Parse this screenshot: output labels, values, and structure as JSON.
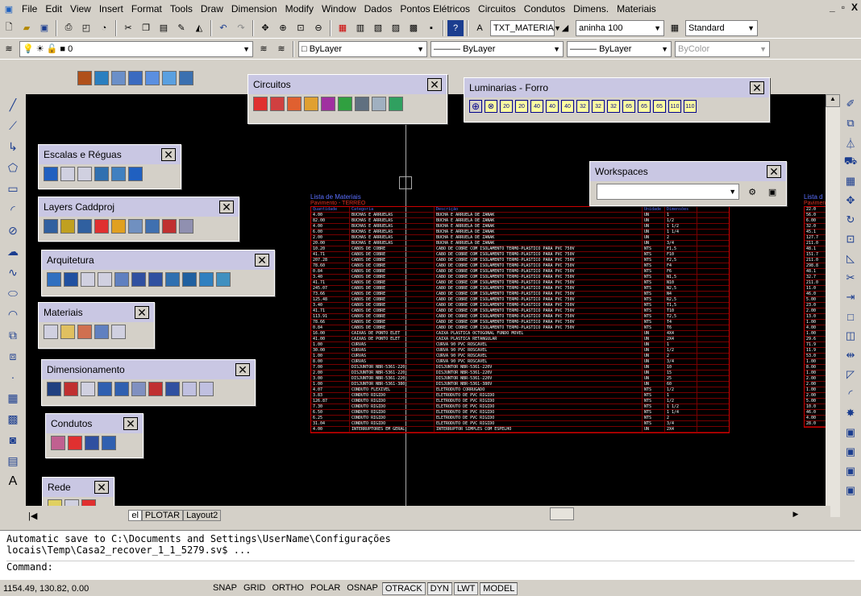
{
  "menu": [
    "File",
    "Edit",
    "View",
    "Insert",
    "Format",
    "Tools",
    "Draw",
    "Dimension",
    "Modify",
    "Window",
    "Dados",
    "Pontos Elétricos",
    "Circuitos",
    "Condutos",
    "Dimens.",
    "Materiais"
  ],
  "window_buttons": {
    "min": "_",
    "max": "▫",
    "close": "X"
  },
  "toolbar1": {
    "style_combo": "TXT_MATERIA",
    "dim_combo": "aninha 100",
    "table_combo": "Standard"
  },
  "toolbar2": {
    "layer_combo": "0",
    "color_combo": "ByLayer",
    "ltype_combo": "ByLayer",
    "lweight_combo": "ByLayer",
    "plot_combo": "ByColor"
  },
  "panels": {
    "circuitos": {
      "title": "Circuitos"
    },
    "luminarias": {
      "title": "Luminarias - Forro",
      "labels": [
        "20",
        "20",
        "40",
        "40",
        "40",
        "32",
        "32",
        "32",
        "65",
        "65",
        "65",
        "110",
        "110"
      ]
    },
    "escalas": {
      "title": "Escalas e Réguas"
    },
    "layers": {
      "title": "Layers Caddproj"
    },
    "arquitetura": {
      "title": "Arquitetura"
    },
    "materiais": {
      "title": "Materiais"
    },
    "dimensionamento": {
      "title": "Dimensionamento"
    },
    "condutos": {
      "title": "Condutos"
    },
    "rede": {
      "title": "Rede"
    },
    "workspaces": {
      "title": "Workspaces"
    }
  },
  "drawing": {
    "table_title": "Lista de Materiais",
    "table_subtitle": "Pavimento - TERREO",
    "headers": [
      "Quantidade",
      "Categoria",
      "Descrição",
      "Unidade",
      "Dimensões"
    ],
    "rows": [
      [
        "4.00",
        "BUCHAS E ARRUELAS",
        "BUCHA E ARRUELA DE ZANAK",
        "UN",
        "1"
      ],
      [
        "82.00",
        "BUCHAS E ARRUELAS",
        "BUCHA E ARRUELA DE ZANAK",
        "UN",
        "1/2"
      ],
      [
        "4.00",
        "BUCHAS E ARRUELAS",
        "BUCHA E ARRUELA DE ZANAK",
        "UN",
        "1 1/2"
      ],
      [
        "6.00",
        "BUCHAS E ARRUELAS",
        "BUCHA E ARRUELA DE ZANAK",
        "UN",
        "1 1/4"
      ],
      [
        "2.00",
        "BUCHAS E ARRUELAS",
        "BUCHA E ARRUELA DE ZANAK",
        "UN",
        "2"
      ],
      [
        "20.00",
        "BUCHAS E ARRUELAS",
        "BUCHA E ARRUELA DE ZANAK",
        "UN",
        "3/4"
      ],
      [
        "10.20",
        "CABOS DE COBRE",
        "CABO DE COBRE COM ISOLAMENTO TERMO-PLASTICO PARA PVC 750V",
        "NTS",
        "F1,5"
      ],
      [
        "41.71",
        "CABOS DE COBRE",
        "CABO DE COBRE COM ISOLAMENTO TERMO-PLASTICO PARA PVC 750V",
        "NTS",
        "F10"
      ],
      [
        "207.28",
        "CABOS DE COBRE",
        "CABO DE COBRE COM ISOLAMENTO TERMO-PLASTICO PARA PVC 750V",
        "NTS",
        "F2,5"
      ],
      [
        "78.60",
        "CABOS DE COBRE",
        "CABO DE COBRE COM ISOLAMENTO TERMO-PLASTICO PARA PVC 750V",
        "NTS",
        "F4"
      ],
      [
        "0.84",
        "CABOS DE COBRE",
        "CABO DE COBRE COM ISOLAMENTO TERMO-PLASTICO PARA PVC 750V",
        "NTS",
        "F6"
      ],
      [
        "3.40",
        "CABOS DE COBRE",
        "CABO DE COBRE COM ISOLAMENTO TERMO-PLASTICO PARA PVC 750V",
        "NTS",
        "N1,5"
      ],
      [
        "41.71",
        "CABOS DE COBRE",
        "CABO DE COBRE COM ISOLAMENTO TERMO-PLASTICO PARA PVC 750V",
        "NTS",
        "N10"
      ],
      [
        "245.07",
        "CABOS DE COBRE",
        "CABO DE COBRE COM ISOLAMENTO TERMO-PLASTICO PARA PVC 750V",
        "NTS",
        "N2,5"
      ],
      [
        "73.66",
        "CABOS DE COBRE",
        "CABO DE COBRE COM ISOLAMENTO TERMO-PLASTICO PARA PVC 750V",
        "NTS",
        "N4"
      ],
      [
        "125.48",
        "CABOS DE COBRE",
        "CABO DE COBRE COM ISOLAMENTO TERMO-PLASTICO PARA PVC 750V",
        "NTS",
        "R2,5"
      ],
      [
        "3.40",
        "CABOS DE COBRE",
        "CABO DE COBRE COM ISOLAMENTO TERMO-PLASTICO PARA PVC 750V",
        "NTS",
        "T1,5"
      ],
      [
        "41.71",
        "CABOS DE COBRE",
        "CABO DE COBRE COM ISOLAMENTO TERMO-PLASTICO PARA PVC 750V",
        "NTS",
        "T10"
      ],
      [
        "113.91",
        "CABOS DE COBRE",
        "CABO DE COBRE COM ISOLAMENTO TERMO-PLASTICO PARA PVC 750V",
        "NTS",
        "T2,5"
      ],
      [
        "78.66",
        "CABOS DE COBRE",
        "CABO DE COBRE COM ISOLAMENTO TERMO-PLASTICO PARA PVC 750V",
        "NTS",
        "T4"
      ],
      [
        "0.84",
        "CABOS DE COBRE",
        "CABO DE COBRE COM ISOLAMENTO TERMO-PLASTICO PARA PVC 750V",
        "NTS",
        "T6"
      ],
      [
        "16.00",
        "CAIXAS DE PONTO ELET",
        "CAIXA PLASTICA OCTOGONAL FUNDO MOVEL",
        "UN",
        "4X4"
      ],
      [
        "41.00",
        "CAIXAS DE PONTO ELET",
        "CAIXA PLASTICA RETANGULAR",
        "UN",
        "2X4"
      ],
      [
        "1.00",
        "CURVAS",
        "CURVA 90 PVC ROSCAVEL",
        "UN",
        "1"
      ],
      [
        "30.00",
        "CURVAS",
        "CURVA 90 PVC ROSCAVEL",
        "UN",
        "1/2"
      ],
      [
        "1.00",
        "CURVAS",
        "CURVA 90 PVC ROSCAVEL",
        "UN",
        "2"
      ],
      [
        "8.00",
        "CURVAS",
        "CURVA 90 PVC ROSCAVEL",
        "UN",
        "3/4"
      ],
      [
        "7.00",
        "DISJUNTOR NBR-5361-220",
        "DISJUNTOR NBR-5361-220V",
        "UN",
        "10"
      ],
      [
        "2.00",
        "DISJUNTOR NBR-5361-220",
        "DISJUNTOR NBR-5361-220V",
        "UN",
        "15"
      ],
      [
        "3.00",
        "DISJUNTOR NBR-5361-220",
        "DISJUNTOR NBR-5361-220V",
        "UN",
        "25"
      ],
      [
        "1.00",
        "DISJUNTOR NBR-5361-380",
        "DISJUNTOR NBR-5361-380V",
        "UN",
        "60"
      ],
      [
        "4.07",
        "CONDUTO FLEXIVEL",
        "ELETRODUTO CORRUGADO",
        "NTS",
        "1/2"
      ],
      [
        "3.83",
        "CONDUTO RIGIDO",
        "ELETRODUTO DE PVC RIGIDO",
        "NTS",
        "1"
      ],
      [
        "126.87",
        "CONDUTO RIGIDO",
        "ELETRODUTO DE PVC RIGIDO",
        "NTS",
        "1/2"
      ],
      [
        "7.30",
        "CONDUTO RIGIDO",
        "ELETRODUTO DE PVC RIGIDO",
        "NTS",
        "1 1/2"
      ],
      [
        "6.50",
        "CONDUTO RIGIDO",
        "ELETRODUTO DE PVC RIGIDO",
        "NTS",
        "1 1/4"
      ],
      [
        "6.25",
        "CONDUTO RIGIDO",
        "ELETRODUTO DE PVC RIGIDO",
        "NTS",
        "2"
      ],
      [
        "31.04",
        "CONDUTO RIGIDO",
        "ELETRODUTO DE PVC RIGIDO",
        "NTS",
        "3/4"
      ],
      [
        "4.00",
        "INTERRUPTORES EM GERAL",
        "INTERRUPTOR SIMPLES COM ESPELHO",
        "UN",
        "2X4"
      ]
    ],
    "table2_title": "Lista d",
    "table2_sub": "Paviment",
    "table2_values": [
      "22.0",
      "56.0",
      "6.00",
      "32.0",
      "45.1",
      "127.7",
      "211.0",
      "48.1",
      "151.7",
      "211.0",
      "298.8",
      "48.1",
      "32.7",
      "211.0",
      "11.0",
      "46.0",
      "5.00",
      "23.0",
      "2.00",
      "13.0",
      "1.00",
      "4.00",
      "1.00",
      "29.6",
      "71.9",
      "11.9",
      "53.0",
      "1.00",
      "8.00",
      "1.00",
      "2.00",
      "2.00",
      "1.00",
      "2.00",
      "5.00",
      "10.0",
      "46.0",
      "4.00",
      "28.0"
    ]
  },
  "tabs": [
    "el",
    "PLOTAR",
    "Layout2"
  ],
  "command": {
    "line1": "Automatic save to C:\\Documents and Settings\\UserName\\Configurações",
    "line2": "locais\\Temp\\Casa2_recover_1_1_5279.sv$ ...",
    "prompt": "Command:"
  },
  "status": {
    "coords": "1154.49, 130.82, 0.00",
    "buttons": [
      "SNAP",
      "GRID",
      "ORTHO",
      "POLAR",
      "OSNAP",
      "OTRACK",
      "DYN",
      "LWT",
      "MODEL"
    ],
    "active": [
      "OTRACK",
      "DYN",
      "LWT",
      "MODEL"
    ]
  },
  "colors": {
    "canvas": "#000000",
    "table_border": "#cc0000",
    "panel_title": "#c9c7e3"
  }
}
